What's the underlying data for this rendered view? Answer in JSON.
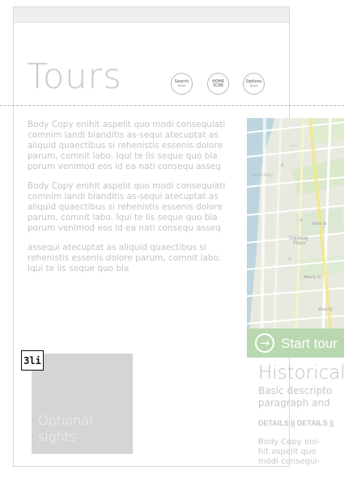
{
  "page": {
    "title": "Tours"
  },
  "header_buttons": [
    {
      "label": "Search",
      "sub": "Board"
    },
    {
      "label": "HOME ICON",
      "sub": ""
    },
    {
      "label": "Options",
      "sub": "Board"
    }
  ],
  "body": {
    "paragraph_1": "Body Copy enihit aspelit quo modi consequiati comnim landi blanditis as-sequi atecuptat as aliquid quaectibus si rehenistis essenis dolore parum, comnit labo. Iqui te lis seque quo bla porum venimod eos id ea nati consequ asseq",
    "paragraph_2": "Body Copy enihit aspelit quo modi consequiati comnim landi blanditis as-sequi atecuptat as aliquid quaectibus si rehenistis essenis dolore parum, comnit labo. Iqui te lis seque quo bla porum venimod eos id ea nati consequ asseq",
    "paragraph_3": "assequi atecuptat as aliquid quaectibus si rehenistis essenis dolore parum, comnit labo. Iqui te lis seque quo bla"
  },
  "tag": {
    "label": "3li"
  },
  "optional": {
    "label_line_1": "Optional",
    "label_line_2": "sights"
  },
  "map_card": {
    "start_label": "Start tour"
  },
  "historical": {
    "heading": "Historical",
    "desc_line_1": "Basic descripto",
    "desc_line_2": "paragraph and",
    "details_1": "DETAILS",
    "details_2": "DETAILS",
    "body_line_1": "Body Copy eni-",
    "body_line_2": "hit aspelit quo",
    "body_line_3": "modi consequi-"
  },
  "colors": {
    "title": "#c9c9c9",
    "body": "#c4c4c4",
    "tour_bar": "#b9d8b0",
    "optional_box": "#d5d5d5"
  },
  "icons": {
    "arrow_right": "arrow-right-icon",
    "map": "map-icon"
  }
}
